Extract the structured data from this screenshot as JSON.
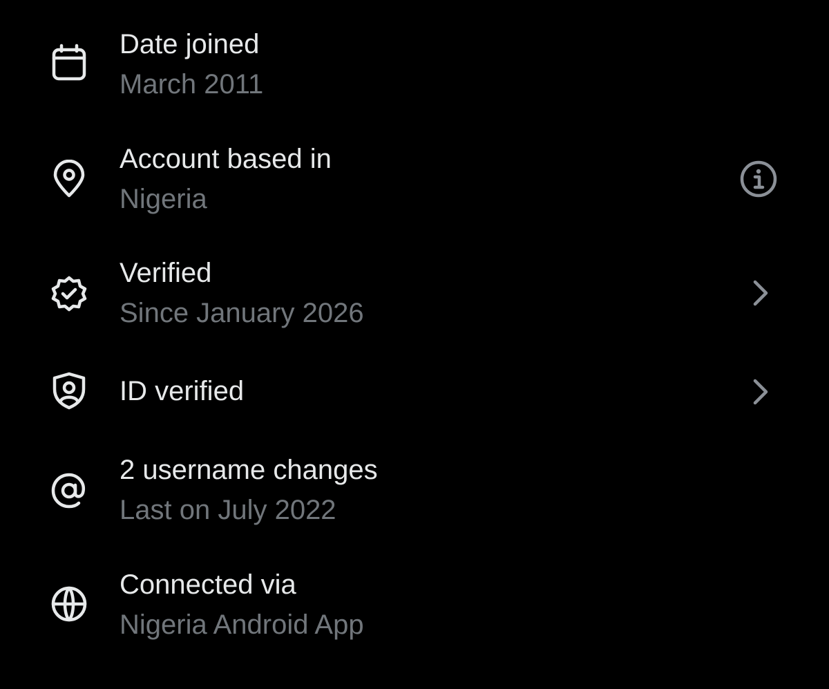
{
  "rows": [
    {
      "title": "Date joined",
      "subtitle": "March 2011",
      "icon": "calendar-icon"
    },
    {
      "title": "Account based in",
      "subtitle": "Nigeria",
      "icon": "location-pin-icon",
      "trailing_icon": "info-icon"
    },
    {
      "title": "Verified",
      "subtitle": "Since January 2026",
      "icon": "verified-badge-icon",
      "trailing_icon": "chevron-right-icon"
    },
    {
      "title": "ID verified",
      "icon": "id-shield-icon",
      "trailing_icon": "chevron-right-icon"
    },
    {
      "title": "2 username changes",
      "subtitle": "Last on July 2022",
      "icon": "at-sign-icon"
    },
    {
      "title": "Connected via",
      "subtitle": "Nigeria Android App",
      "icon": "globe-icon"
    }
  ],
  "colors": {
    "background": "#000000",
    "primary_text": "#e7e9ea",
    "secondary_text": "#71767b"
  }
}
